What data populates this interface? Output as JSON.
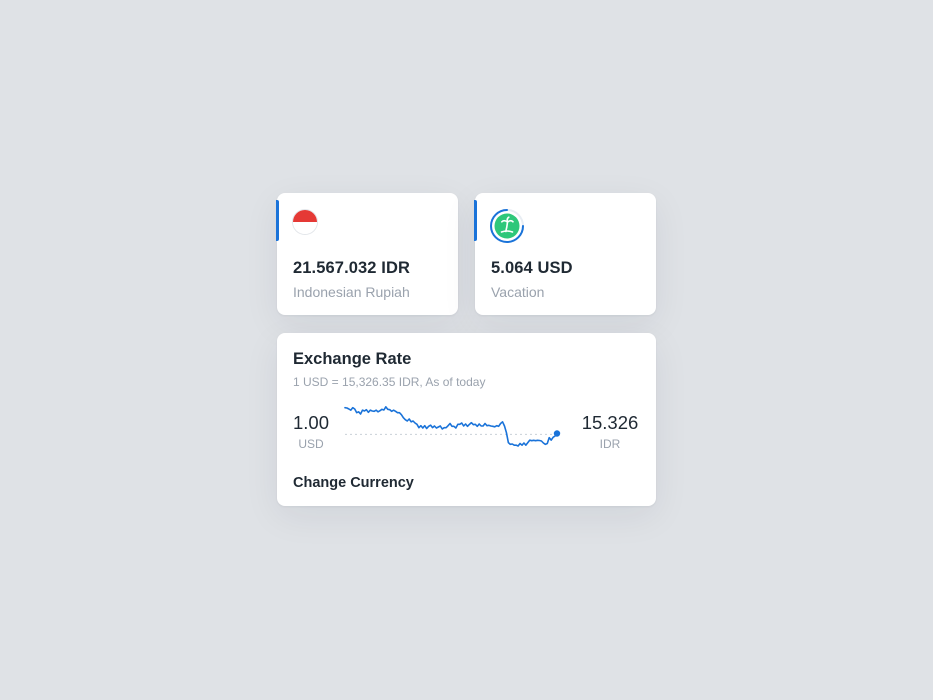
{
  "colors": {
    "background": "#dfe2e6",
    "card": "#ffffff",
    "accent": "#1a73d9",
    "text_primary": "#1f2933",
    "text_secondary": "#9aa2ad",
    "flag_red": "#e53935",
    "goal_green": "#2ec77a"
  },
  "balance_card": {
    "icon": "indonesia-flag-icon",
    "amount": "21.567.032 IDR",
    "name": "Indonesian Rupiah"
  },
  "goal_card": {
    "icon": "palm-tree-icon",
    "amount": "5.064 USD",
    "name": "Vacation"
  },
  "exchange": {
    "title": "Exchange Rate",
    "subtitle": "1 USD = 15,326.35 IDR, As of today",
    "from_value": "1.00",
    "from_code": "USD",
    "to_value": "15.326",
    "to_code": "IDR",
    "action_label": "Change Currency"
  },
  "chart_data": {
    "type": "line",
    "title": "",
    "xlabel": "",
    "ylabel": "",
    "baseline": 15430,
    "ylim": [
      15300,
      15600
    ],
    "series": [
      {
        "values": [
          15590,
          15588,
          15582,
          15575,
          15590,
          15582,
          15560,
          15565,
          15552,
          15575,
          15570,
          15578,
          15562,
          15575,
          15570,
          15568,
          15575,
          15565,
          15572,
          15580,
          15576,
          15595,
          15580,
          15578,
          15568,
          15575,
          15568,
          15560,
          15560,
          15548,
          15530,
          15518,
          15510,
          15522,
          15505,
          15510,
          15498,
          15490,
          15470,
          15482,
          15468,
          15482,
          15465,
          15478,
          15485,
          15470,
          15480,
          15468,
          15474,
          15480,
          15462,
          15470,
          15470,
          15482,
          15495,
          15478,
          15478,
          15468,
          15490,
          15490,
          15498,
          15480,
          15492,
          15478,
          15490,
          15500,
          15488,
          15490,
          15478,
          15492,
          15480,
          15480,
          15495,
          15482,
          15484,
          15480,
          15478,
          15475,
          15482,
          15478,
          15495,
          15505,
          15480,
          15440,
          15380,
          15370,
          15372,
          15365,
          15365,
          15360,
          15375,
          15365,
          15378,
          15365,
          15380,
          15395,
          15392,
          15394,
          15392,
          15394,
          15393,
          15390,
          15378,
          15370,
          15375,
          15410,
          15395,
          15412,
          15420,
          15435
        ]
      }
    ]
  }
}
